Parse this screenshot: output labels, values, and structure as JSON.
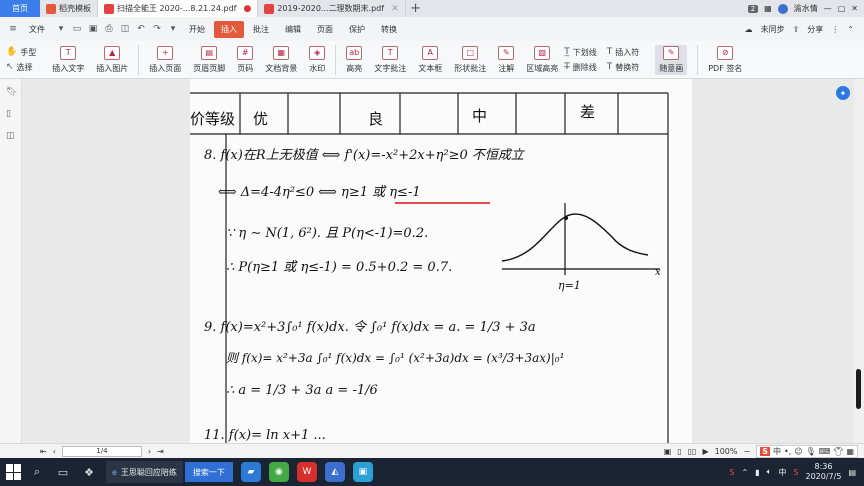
{
  "tabs": {
    "home": "首页",
    "items": [
      {
        "label": "稻壳模板",
        "icon_color": "#e25a3b"
      },
      {
        "label": "扫描全能王 2020-...8.21.24.pdf",
        "icon_color": "#e04343"
      },
      {
        "label": "2019-2020...二理数期末.pdf",
        "icon_color": "#e04343"
      }
    ],
    "add": "+",
    "count_badge": "2",
    "user": "渝水情"
  },
  "menubar": {
    "file": "文件",
    "items": [
      "开始",
      "插入",
      "批注",
      "编辑",
      "页面",
      "保护",
      "转换"
    ],
    "active": "插入",
    "sync": "未同步",
    "share": "分享"
  },
  "ribbon": {
    "hand": "手型",
    "select": "选择",
    "big_buttons": [
      "插入文字",
      "插入图片",
      "插入页面",
      "页眉页脚",
      "页码",
      "文档背景",
      "水印",
      "高亮",
      "文字批注",
      "文本框",
      "形状批注",
      "注解",
      "区域高亮"
    ],
    "small_a": [
      "下划线",
      "删除线"
    ],
    "small_b": [
      "插入符",
      "替换符"
    ],
    "pen": "随意画",
    "pdf_sign": "PDF 签名"
  },
  "document": {
    "header_cells": [
      "价等级",
      "优",
      "良",
      "中",
      "差"
    ],
    "lines": [
      "8. f(x)在R上无极值 ⟺ f'(x)=-x²+2x+η²≥0 不恒成立",
      "⟺ Δ=4-4η²≤0 ⟺ η≥1 或 η≤-1",
      "∵ η ∼ N(1, 6²). 且 P(η<-1)=0.2.",
      "∴ P(η≥1 或 η≤-1) = 0.5+0.2 = 0.7.",
      "9.  f(x)=x²+3∫₀¹ f(x)dx. 令 ∫₀¹ f(x)dx = a.   = 1/3 + 3a",
      "则 f(x)= x²+3a    ∫₀¹ f(x)dx = ∫₀¹ (x²+3a)dx = (x³/3+3ax)|₀¹",
      "∴ a = 1/3 + 3a    a = -1/6",
      "11. f(x)= ln x+1 ..."
    ],
    "graph_label": "η=1",
    "axis_label": "x"
  },
  "statusbar": {
    "page": "1/4",
    "zoom": "100%",
    "ime": "中"
  },
  "taskbar": {
    "app_label": "王思聪回应陪练",
    "search_label": "搜索一下",
    "time": "8:36",
    "date": "2020/7/5",
    "tray_lang": "中"
  }
}
